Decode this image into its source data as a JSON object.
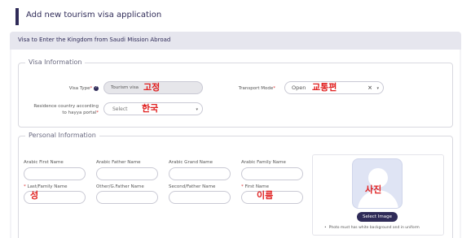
{
  "page": {
    "title": "Add new tourism visa application"
  },
  "card": {
    "header": "Visa to Enter the Kingdom from Saudi Mission Abroad"
  },
  "visa_info": {
    "legend": "Visa Information",
    "visa_type": {
      "label": "Visa Type",
      "required": "*",
      "help": "?",
      "value": "Tourism visa"
    },
    "transport_mode": {
      "label": "Transport Mode",
      "required": "*",
      "value": "Open",
      "clear": "×",
      "caret": "▾"
    },
    "residence_country": {
      "label_line1": "Residence country according",
      "label_line2": "to hayya portal",
      "required": "*",
      "placeholder": "Select",
      "caret": "▾"
    },
    "annotations": {
      "visa_type": "고정",
      "transport_mode": "교통편",
      "residence_country": "한국"
    }
  },
  "personal_info": {
    "legend": "Personal Information",
    "fields": {
      "arabic_first_name": {
        "label": "Arabic First Name"
      },
      "arabic_father_name": {
        "label": "Arabic Father Name"
      },
      "arabic_grand_name": {
        "label": "Arabic Grand Name"
      },
      "arabic_family_name": {
        "label": "Arabic Family Name"
      },
      "last_family_name": {
        "label": "Last/Family Name",
        "required": "*"
      },
      "other_father_name": {
        "label": "Other/G.Father Name"
      },
      "second_father_name": {
        "label": "Second/Father Name"
      },
      "first_name": {
        "label": "First Name",
        "required": "*"
      }
    },
    "annotations": {
      "last_name": "성",
      "first_name": "이름",
      "photo": "사진"
    },
    "photo": {
      "button": "Select Image",
      "note": "Photo must has white background and in uniform"
    }
  }
}
